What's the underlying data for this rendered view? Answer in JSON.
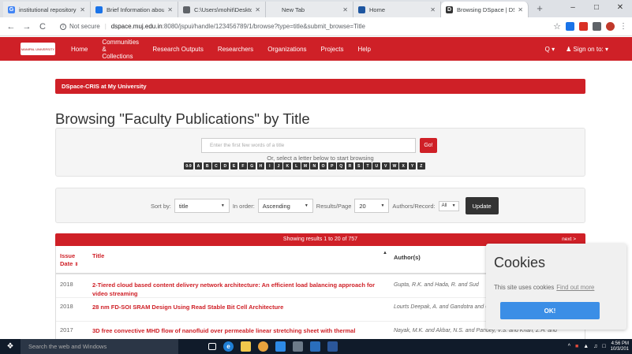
{
  "browser": {
    "tabs": [
      {
        "title": "institutional repository",
        "favicon": "G",
        "favicon_color": "#4285f4",
        "active": false
      },
      {
        "title": "Brief Information abou",
        "favicon": "mail",
        "favicon_color": "#1a73e8",
        "active": false
      },
      {
        "title": "C:\\Users\\mohit\\Deskto",
        "favicon": "globe",
        "favicon_color": "#5f6368",
        "active": false
      },
      {
        "title": "New Tab",
        "favicon": "",
        "favicon_color": "#e8eaed",
        "active": false
      },
      {
        "title": "Home",
        "favicon": "home",
        "favicon_color": "#1e56a0",
        "active": false
      },
      {
        "title": "Browsing DSpace | DSp",
        "favicon": "D",
        "favicon_color": "#333333",
        "active": true
      }
    ],
    "new_tab": "+",
    "minimize": "–",
    "maximize": "□",
    "close": "✕",
    "back": "←",
    "forward": "→",
    "reload": "C",
    "security_label": "Not secure",
    "url_host": "dspace.muj.edu.in",
    "url_rest": ":8080/jspui/handle/123456789/1/browse?type=title&submit_browse=Title",
    "star": "☆"
  },
  "site": {
    "brand_color": "#cf2027",
    "logo_text": "MANIPAL UNIVERSITY",
    "nav": [
      {
        "label": "Home"
      },
      {
        "label": "Communities & Collections"
      },
      {
        "label": "Research Outputs"
      },
      {
        "label": "Researchers"
      },
      {
        "label": "Organizations"
      },
      {
        "label": "Projects"
      },
      {
        "label": "Help"
      }
    ],
    "search_menu": "Q",
    "signin": "Sign on to:"
  },
  "breadcrumb": "DSpace-CRIS at My University",
  "page_title": "Browsing \"Faculty Publications\" by Title",
  "search": {
    "placeholder": "Enter the first few words of a title",
    "go_label": "Go!",
    "letter_hint": "Or, select a letter below to start browsing",
    "letters": [
      "0-9",
      "A",
      "B",
      "C",
      "D",
      "E",
      "F",
      "G",
      "H",
      "I",
      "J",
      "K",
      "L",
      "M",
      "N",
      "O",
      "P",
      "Q",
      "R",
      "S",
      "T",
      "U",
      "V",
      "W",
      "X",
      "Y",
      "Z"
    ]
  },
  "sort": {
    "sort_by_label": "Sort by:",
    "sort_by_value": "title",
    "in_order_label": "In order:",
    "in_order_value": "Ascending",
    "per_page_label": "Results/Page",
    "per_page_value": "20",
    "authors_label": "Authors/Record:",
    "authors_value": "All",
    "update_label": "Update"
  },
  "results": {
    "summary": "Showing results 1 to 20 of 757",
    "next": "next >",
    "columns": {
      "date": "Issue Date",
      "title": "Title",
      "author": "Author(s)"
    },
    "rows": [
      {
        "year": "2018",
        "title": "2-Tiered cloud based content delivery network architecture: An efficient load balancing approach for video streaming",
        "authors": "Gupta, R.K. and Hada, R. and Sud"
      },
      {
        "year": "2018",
        "title": "28 nm FD-SOI SRAM Design Using Read Stable Bit Cell Architecture",
        "authors": "Lourts Deepak, A. and Gandotra and Umadevi, S."
      },
      {
        "year": "2017",
        "title": "3D free convective MHD flow of nanofluid over permeable linear stretching sheet with thermal",
        "authors": "Nayak, M.K. and Akbar, N.S. and Pandey, V.S. and Khan, Z.H. and"
      }
    ]
  },
  "cookie": {
    "title": "Cookies",
    "message": "This site uses cookies",
    "link": "Find out more",
    "ok": "OK!"
  },
  "taskbar": {
    "search_placeholder": "Search the web and Windows",
    "time": "4:56 PM",
    "date": "10/3/201"
  }
}
